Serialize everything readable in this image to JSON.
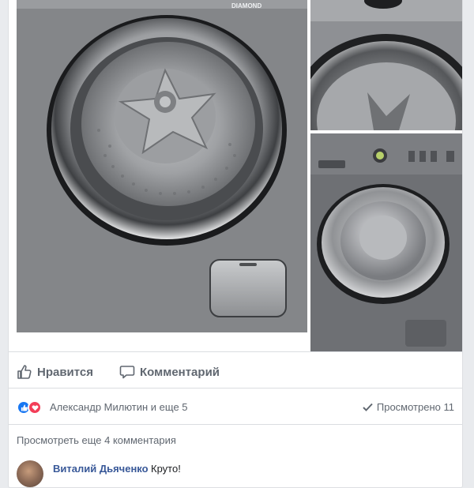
{
  "post": {
    "photos": [
      "washing-machine-door-closeup",
      "washing-machine-control-panel",
      "washing-machine-front"
    ],
    "brand_text": "DIAMOND"
  },
  "actions": {
    "like_label": "Нравится",
    "comment_label": "Комментарий"
  },
  "reactions": {
    "summary": "Александр Милютин и еще 5",
    "views": "Просмотрено 11",
    "icons": [
      "like-icon",
      "love-icon"
    ],
    "colors": {
      "like": "#1877f2",
      "love": "#f33e58"
    }
  },
  "comments": {
    "view_more": "Просмотреть еще 4 комментария",
    "items": [
      {
        "author": "Виталий Дьяченко",
        "text": "Круто!"
      }
    ]
  }
}
